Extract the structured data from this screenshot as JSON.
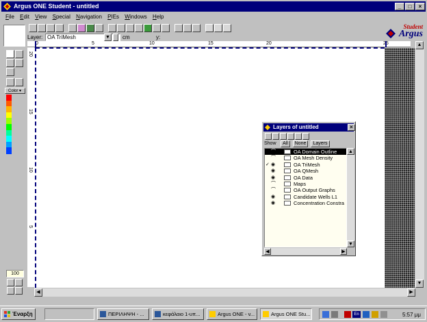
{
  "window": {
    "title": "Argus ONE Student - untitled"
  },
  "menu": [
    {
      "key": "F",
      "rest": "ile"
    },
    {
      "key": "E",
      "rest": "dit"
    },
    {
      "key": "V",
      "rest": "iew"
    },
    {
      "key": "S",
      "rest": "pecial"
    },
    {
      "key": "N",
      "rest": "avigation"
    },
    {
      "key": "P",
      "rest": "IEs"
    },
    {
      "key": "W",
      "rest": "indows"
    },
    {
      "key": "H",
      "rest": "elp"
    }
  ],
  "layer_bar": {
    "label": "Layer:",
    "value": "OA TriMesh",
    "x_readout": "cm x: 20.1",
    "y_readout": "y: 42.45"
  },
  "logo": {
    "top": "Student",
    "main": "Argus"
  },
  "ruler": {
    "top_ticks": [
      "0",
      "5",
      "10",
      "15",
      "20",
      "25"
    ],
    "left_ticks": [
      "20",
      "15",
      "10",
      "5"
    ]
  },
  "palette": {
    "color_label": "Color",
    "colors": [
      "#ff0000",
      "#ff5a00",
      "#ffb400",
      "#ffff00",
      "#9cff00",
      "#00ff00",
      "#00ff9c",
      "#00ffff",
      "#00a0ff",
      "#0040ff"
    ],
    "zoom": "100"
  },
  "layers_window": {
    "title": "Layers of untitled",
    "show_label": "Show",
    "all_label": "All",
    "none_label": "None",
    "layers_button": "Layers",
    "rows": [
      {
        "check": "",
        "eye": "⌒",
        "label": "OA Domain Outline",
        "selected": true
      },
      {
        "check": "",
        "eye": "⌒",
        "label": "OA Mesh Density",
        "selected": false
      },
      {
        "check": "✓",
        "eye": "◉",
        "label": "OA TriMesh",
        "selected": false
      },
      {
        "check": "",
        "eye": "◉",
        "label": "OA QMesh",
        "selected": false
      },
      {
        "check": "",
        "eye": "◉",
        "label": "OA Data",
        "selected": false
      },
      {
        "check": "",
        "eye": "⌒",
        "label": "Maps",
        "selected": false
      },
      {
        "check": "",
        "eye": "⌒",
        "label": "OA Output Graphs",
        "selected": false
      },
      {
        "check": "",
        "eye": "◉",
        "label": "Candidate Wells L1",
        "selected": false
      },
      {
        "check": "",
        "eye": "◉",
        "label": "Concentration Constra",
        "selected": false
      }
    ]
  },
  "taskbar": {
    "start": "Έναρξη",
    "tasks": [
      "",
      "ΠΕΡΙΛΗΨΗ - ...",
      "κεφάλαιο 1-υπ...",
      "Argus ONE - v...",
      "Argus ONE Stu..."
    ],
    "tray_lang": "En",
    "clock": "5:57 μμ"
  }
}
